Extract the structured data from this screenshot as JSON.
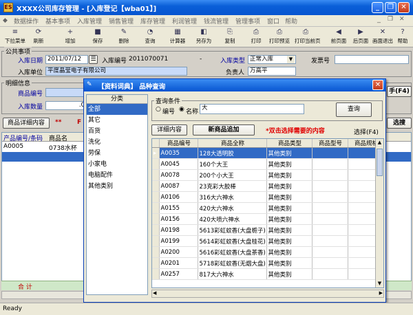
{
  "window": {
    "title": "XXXX公司库存管理 - [入库登记【wba01】]",
    "app_icon": "ES"
  },
  "menu": [
    "数据操作",
    "基本事项",
    "入库管理",
    "销售管理",
    "库存管理",
    "利润管理",
    "钱流管理",
    "管理事项",
    "窗口",
    "帮助"
  ],
  "toolbar": [
    {
      "label": "下拉菜单",
      "icon": "≡"
    },
    {
      "label": "刷新",
      "icon": "⟳"
    },
    {
      "label": "增加",
      "icon": "+"
    },
    {
      "label": "保存",
      "icon": "■"
    },
    {
      "label": "删除",
      "icon": "✎"
    },
    {
      "label": "查询",
      "icon": "◔"
    },
    {
      "label": "计算器",
      "icon": "▦"
    },
    {
      "label": "另存为",
      "icon": "◧"
    },
    {
      "label": "复制",
      "icon": "⎘"
    },
    {
      "label": "打印",
      "icon": "⎙"
    },
    {
      "label": "打印预览",
      "icon": "⎙"
    },
    {
      "label": "打印当前页",
      "icon": "⎙"
    },
    {
      "label": "前页面",
      "icon": "◀"
    },
    {
      "label": "后页面",
      "icon": "▶"
    },
    {
      "label": "画面退出",
      "icon": "✕"
    },
    {
      "label": "帮助",
      "icon": "?"
    }
  ],
  "public": {
    "group_title": "公共事项",
    "date_label": "入库日期",
    "date_value": "2011/07/12",
    "no_label": "入库编号",
    "no_value": "2011070071",
    "no_suffix": "-",
    "type_label": "入库类型",
    "type_value": "正常入库",
    "invoice_label": "发票号",
    "unit_label": "入库单位",
    "unit_value": "平度晶莹电子有限公司",
    "person_label": "负责人",
    "person_value": "万高平"
  },
  "detail": {
    "group_title": "明细信息",
    "code_label": "商品编号",
    "qty_label": "入库数量",
    "qty_value": ".0",
    "tab_label": "商品详细内容",
    "flag": "**",
    "flag2": "F",
    "grid_headers": [
      "产品编号/条码",
      "商品名"
    ],
    "grid_rows": [
      [
        "A0005",
        "0738水杯"
      ]
    ],
    "total_label": "合 计",
    "right_btn": "手(F4)",
    "right_btn2": "选搜"
  },
  "dialog": {
    "title": "【资料词典】 品种查询",
    "cat_header": "分类",
    "categories": [
      "全部",
      "其它",
      "百货",
      "洗化",
      "劳保",
      "小家电",
      "电脑配件",
      "其他类别"
    ],
    "selected_category": 0,
    "query_group": "查询条件",
    "radio_code": "编号",
    "radio_name": "名称",
    "query_value": "大",
    "query_button": "查询",
    "detail_button": "详细内容",
    "new_button": "新商品追加",
    "hint": "*双击选择需要的内容",
    "select_label": "选择(F4)",
    "headers": [
      "商品编号",
      "商品全称",
      "商品类型",
      "商品型号",
      "商品规格"
    ],
    "rows": [
      [
        "A0035",
        "128大透明胶",
        "其他类别"
      ],
      [
        "A0045",
        "160个大王",
        "其他类别"
      ],
      [
        "A0078",
        "200个小大王",
        "其他类别"
      ],
      [
        "A0087",
        "23克彩大胶棒",
        "其他类别"
      ],
      [
        "A0106",
        "316大六神水",
        "其他类别"
      ],
      [
        "A0155",
        "420大六神水",
        "其他类别"
      ],
      [
        "A0156",
        "420大喷六神水",
        "其他类别"
      ],
      [
        "A0198",
        "5613彩虹蚊香(大盘栀子)",
        "其他类别"
      ],
      [
        "A0199",
        "5614彩虹蚊香(大盘桂花)",
        "其他类别"
      ],
      [
        "A0200",
        "5616彩虹蚊香(大盘茶香)",
        "其他类别"
      ],
      [
        "A0201",
        "5718彩虹蚊香(无烟大盘)",
        "其他类别"
      ],
      [
        "A0257",
        "817大六神水",
        "其他类别"
      ]
    ]
  },
  "status": "Ready"
}
